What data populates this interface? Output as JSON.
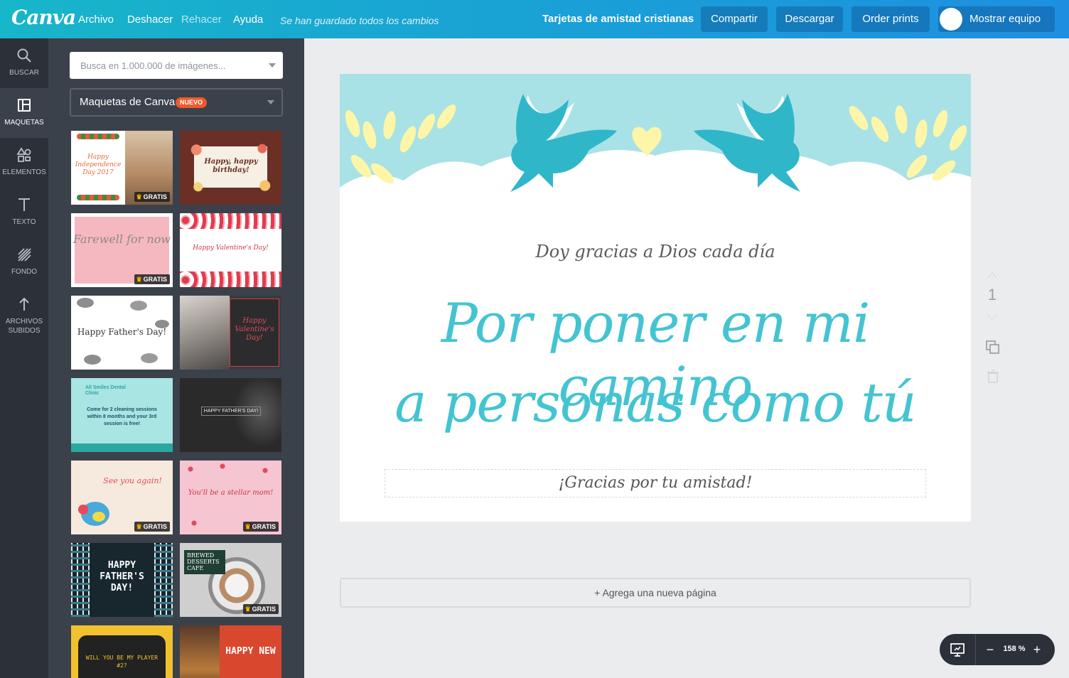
{
  "topbar": {
    "logo": "Canva",
    "menu": [
      "Archivo",
      "Deshacer",
      "Rehacer",
      "Ayuda"
    ],
    "save_status": "Se han guardado todos los cambios",
    "doc_title": "Tarjetas de amistad cristianas",
    "share_label": "Compartir",
    "download_label": "Descargar",
    "order_label": "Order prints",
    "team_label": "Mostrar equipo"
  },
  "rail": {
    "items": [
      {
        "label": "BUSCAR",
        "icon": "search-icon"
      },
      {
        "label": "MAQUETAS",
        "icon": "layout-icon"
      },
      {
        "label": "ELEMENTOS",
        "icon": "shapes-icon"
      },
      {
        "label": "TEXTO",
        "icon": "text-icon"
      },
      {
        "label": "FONDO",
        "icon": "background-icon"
      },
      {
        "label": "ARCHIVOS",
        "label2": "SUBIDOS",
        "icon": "upload-icon"
      }
    ]
  },
  "panel": {
    "search_placeholder": "Busca en 1.000.000 de imágenes...",
    "layout_select": "Maquetas de Canva",
    "new_badge": "NUEVO",
    "badge_free": "GRATIS",
    "templates": [
      {
        "title": "Happy Independence Day 2017",
        "free": true
      },
      {
        "title": "Happy, happy birthday!",
        "free": false
      },
      {
        "title": "Farewell for now",
        "free": true
      },
      {
        "title": "Happy Valentine's Day!",
        "free": false
      },
      {
        "title": "Happy Father's Day!",
        "free": false
      },
      {
        "title": "Happy Valentine's Day!",
        "free": false
      },
      {
        "title": "Come for 2 cleaning sessions within 8 months and your 3rd session is free!",
        "brand": "All Smiles Dental Clinic",
        "free": false
      },
      {
        "title": "HAPPY FATHER'S DAY!",
        "free": false
      },
      {
        "title": "See you again!",
        "free": true
      },
      {
        "title": "You'll be a stellar mom!",
        "free": true
      },
      {
        "title": "HAPPY FATHER'S DAY!",
        "free": false
      },
      {
        "title": "BREWED DESSERTS CAFE",
        "free": true
      },
      {
        "title": "WILL YOU BE MY PLAYER #2?",
        "free": false
      },
      {
        "title": "HAPPY NEW",
        "free": false
      }
    ]
  },
  "card": {
    "line_small": "Doy gracias a Dios cada día",
    "line_big_1": "Por poner en mi camino",
    "line_big_2": "a personas como tú",
    "line_thanks": "¡Gracias por tu amistad!"
  },
  "page_tools": {
    "page_number": "1"
  },
  "add_page_label": "+ Agrega una nueva página",
  "zoom": {
    "value": "158 %"
  },
  "colors": {
    "accent": "#44c4d1",
    "topbar_start": "#17b6c9",
    "topbar_end": "#1e8fe0",
    "rail_bg": "#2b3039",
    "panel_bg": "#3b414b",
    "badge_new": "#ef5a2a",
    "sky": "#a8e2e6",
    "leaf": "#fdf6a8"
  }
}
